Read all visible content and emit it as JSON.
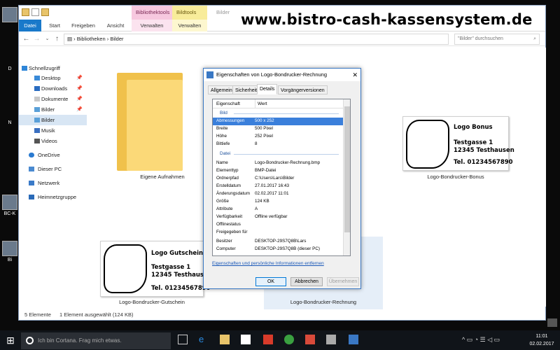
{
  "desktop": {
    "icons": [
      {
        "label": "D"
      },
      {
        "label": "N"
      },
      {
        "label": "BC-K"
      },
      {
        "label": "Bi"
      }
    ]
  },
  "explorer": {
    "context_tabs": [
      "Bibliothektools",
      "Bildtools",
      "Bilder"
    ],
    "ribbon_tabs": [
      "Datei",
      "Start",
      "Freigeben",
      "Ansicht",
      "Verwalten",
      "Verwalten"
    ],
    "breadcrumb": [
      "Bibliotheken",
      "Bilder"
    ],
    "search_placeholder": "\"Bilder\" durchsuchen",
    "nav": {
      "quick_access": "Schnellzugriff",
      "items": [
        {
          "label": "Desktop",
          "pinned": true
        },
        {
          "label": "Downloads",
          "pinned": true
        },
        {
          "label": "Dokumente",
          "pinned": true
        },
        {
          "label": "Bilder",
          "pinned": true
        },
        {
          "label": "Bilder",
          "pinned": false
        },
        {
          "label": "Musik",
          "pinned": false
        },
        {
          "label": "Videos",
          "pinned": false
        }
      ],
      "onedrive": "OneDrive",
      "this_pc": "Dieser PC",
      "network": "Netzwerk",
      "homegroup": "Heimnetzgruppe"
    },
    "items": {
      "folder": "Eigene Aufnahmen",
      "bonus": "Logo-Bondrucker-Bonus",
      "gutschein": "Logo-Bondrucker-Gutschein",
      "rechnung": "Logo-Bondrucker-Rechnung"
    },
    "logos": {
      "bonus": {
        "title": "Logo  Bonus",
        "street": "Testgasse 1",
        "city": "12345 Testhausen",
        "tel": "Tel. 01234567890"
      },
      "gutschein": {
        "title": "Logo  Gutschein",
        "street": "Testgasse 1",
        "city": "12345 Testhausen",
        "tel": "Tel. 01234567890"
      }
    },
    "status": {
      "count": "5 Elemente",
      "selected": "1 Element ausgewählt (124 KB)"
    }
  },
  "watermark": "www.bistro-cash-kassensystem.de",
  "dialog": {
    "title": "Eigenschaften von Logo-Bondrucker-Rechnung",
    "close": "✕",
    "tabs": [
      "Allgemein",
      "Sicherheit",
      "Details",
      "Vorgängerversionen"
    ],
    "head": {
      "k": "Eigenschaft",
      "v": "Wert"
    },
    "group_image": "Bild",
    "image_rows": [
      {
        "k": "Abmessungen",
        "v": "500 x 252"
      },
      {
        "k": "Breite",
        "v": "500 Pixel"
      },
      {
        "k": "Höhe",
        "v": "252 Pixel"
      },
      {
        "k": "Bittiefe",
        "v": "8"
      }
    ],
    "group_file": "Datei",
    "file_rows": [
      {
        "k": "Name",
        "v": "Logo-Bondrucker-Rechnung.bmp"
      },
      {
        "k": "Elementtyp",
        "v": "BMP-Datei"
      },
      {
        "k": "Ordnerpfad",
        "v": "C:\\Users\\Lars\\Bilder"
      },
      {
        "k": "Erstelldatum",
        "v": "27.01.2017 16:43"
      },
      {
        "k": "Änderungsdatum",
        "v": "02.02.2017 11:01"
      },
      {
        "k": "Größe",
        "v": "124 KB"
      },
      {
        "k": "Attribute",
        "v": "A"
      },
      {
        "k": "Verfügbarkeit",
        "v": "Offline verfügbar"
      },
      {
        "k": "Offlinestatus",
        "v": ""
      },
      {
        "k": "Freigegeben für",
        "v": ""
      },
      {
        "k": "Besitzer",
        "v": "DESKTOP-29S7Q8B\\Lars"
      },
      {
        "k": "Computer",
        "v": "DESKTOP-29S7Q8B (dieser PC)"
      }
    ],
    "link": "Eigenschaften und persönliche Informationen entfernen",
    "buttons": {
      "ok": "OK",
      "cancel": "Abbrechen",
      "apply": "Übernehmen"
    }
  },
  "taskbar": {
    "cortana": "Ich bin Cortana. Frag mich etwas.",
    "time": "11:01",
    "date": "02.02.2017"
  },
  "colors": {
    "accent": "#1979ca",
    "selection": "#3a7fdb"
  }
}
